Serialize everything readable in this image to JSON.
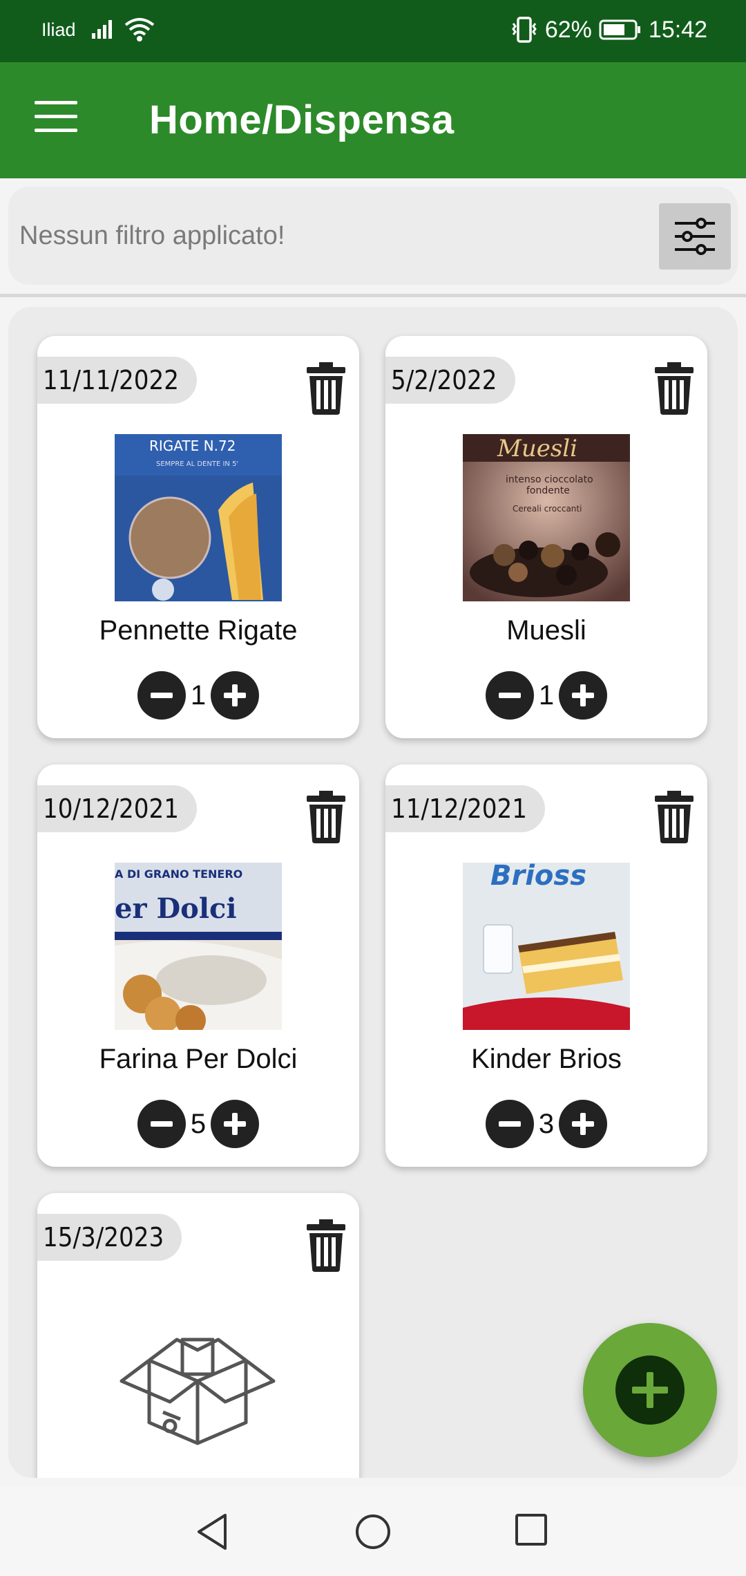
{
  "status_bar": {
    "carrier": "Iliad",
    "battery_percent": "62%",
    "time": "15:42"
  },
  "app_bar": {
    "menu_icon": "hamburger-menu-icon",
    "title": "Home/Dispensa"
  },
  "filter_bar": {
    "text": "Nessun filtro applicato!",
    "icon": "sliders-filter-icon"
  },
  "products": [
    {
      "date": "11/11/2022",
      "name": "Pennette Rigate",
      "quantity": "1",
      "image": "pasta-photo"
    },
    {
      "date": "5/2/2022",
      "name": "Muesli",
      "quantity": "1",
      "image": "muesli-photo"
    },
    {
      "date": "10/12/2021",
      "name": "Farina Per Dolci",
      "quantity": "5",
      "image": "flour-photo"
    },
    {
      "date": "11/12/2021",
      "name": "Kinder Brios",
      "quantity": "3",
      "image": "brioss-photo"
    },
    {
      "date": "15/3/2023",
      "name": "",
      "quantity": "",
      "image": "box-placeholder-icon"
    }
  ],
  "fab": {
    "icon": "plus-icon"
  },
  "colors": {
    "status_bar": "#115c1b",
    "app_bar": "#2d8a2a",
    "fab": "#6aa83a",
    "fab_inner": "#0f2e0a"
  }
}
